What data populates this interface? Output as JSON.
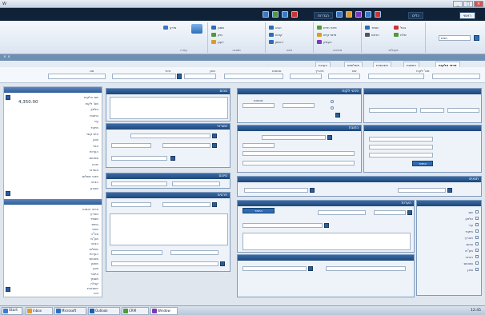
{
  "titlebar": {
    "app": "W"
  },
  "ribbon_tabs": [
    {
      "label": "ראשי",
      "active": true
    },
    {
      "label": "מוצר"
    },
    {
      "label": "לקוח"
    },
    {
      "label": "הזמנה"
    },
    {
      "label": "מלאי"
    },
    {
      "label": "דוחות"
    },
    {
      "label": "כלים"
    },
    {
      "label": "הגדרות"
    }
  ],
  "ribbon": {
    "search_placeholder": "חפש",
    "groups": [
      {
        "title": "פעולות",
        "buttons": [
          "שמור",
          "בטל",
          "הדפס",
          "שלח"
        ]
      },
      {
        "title": "פתיחה",
        "buttons": [
          "פתח חדש",
          "פתח קיים",
          "העתק"
        ]
      },
      {
        "title": "ניווט",
        "buttons": [
          "הבא",
          "קודם",
          "ראשון"
        ]
      },
      {
        "title": "תצוגה",
        "buttons": [
          "מסנן",
          "מיון",
          "רענן"
        ]
      },
      {
        "title": "עזרה",
        "buttons": [
          "מידע"
        ]
      }
    ]
  },
  "subbar": {
    "close": "× ×",
    "title": ""
  },
  "tabs_row": [
    "פרטי הלקוח",
    "הזמנות",
    "חשבוניות",
    "תשלומים",
    "הערות"
  ],
  "filter": {
    "labels": [
      "מס' לקוח",
      "שם",
      "תאריך",
      "סטטוס",
      "סוכן",
      "אזור",
      "סוג"
    ],
    "values": [
      "",
      "",
      "",
      "",
      "",
      "",
      ""
    ]
  },
  "left_pane": {
    "amount": "4,350.00",
    "rows_top": [
      "שם הלקוח",
      "מס' לקוח",
      "טלפון",
      "כתובת",
      "עיר",
      "מיקוד",
      "איש קשר",
      "סוכן",
      "אזור",
      "הערות",
      "סטטוס",
      "יתרה",
      "אשראי",
      "תנאי תשלום",
      "הנחה",
      "מטבע"
    ],
    "rows_bottom": [
      "פרטי הזמנה",
      "תאריך",
      "מספר",
      "כמות",
      "מחיר",
      "סה\"כ",
      "מע\"מ",
      "הנחה",
      "משלוח",
      "הערות",
      "סטטוס",
      "מחסן",
      "סוכן",
      "אישור",
      "מסמך",
      "קבלה",
      "חשבונית",
      "זיכוי"
    ]
  },
  "panels": {
    "p1_title": "פרטי לקוח",
    "p2_title": "כתובת",
    "p3_title": "סכום",
    "p4_title": "אשראי",
    "p5_title": "פרטים",
    "p6_title": "הערות",
    "p7_title": "סיכום",
    "p8_title": "תנאים",
    "field_labels": [
      "שם",
      "טלפון",
      "עיר",
      "מיקוד",
      "תאריך",
      "סכום",
      "מע\"מ",
      "הנחה",
      "סטטוס",
      "סוכן"
    ],
    "ok": "אישור",
    "cancel": "ביטול"
  },
  "taskbar": {
    "start": "Start",
    "tasks": [
      "Inbox",
      "Microsoft",
      "Outlook",
      "CRM",
      "Window"
    ],
    "clock": "12:45"
  }
}
